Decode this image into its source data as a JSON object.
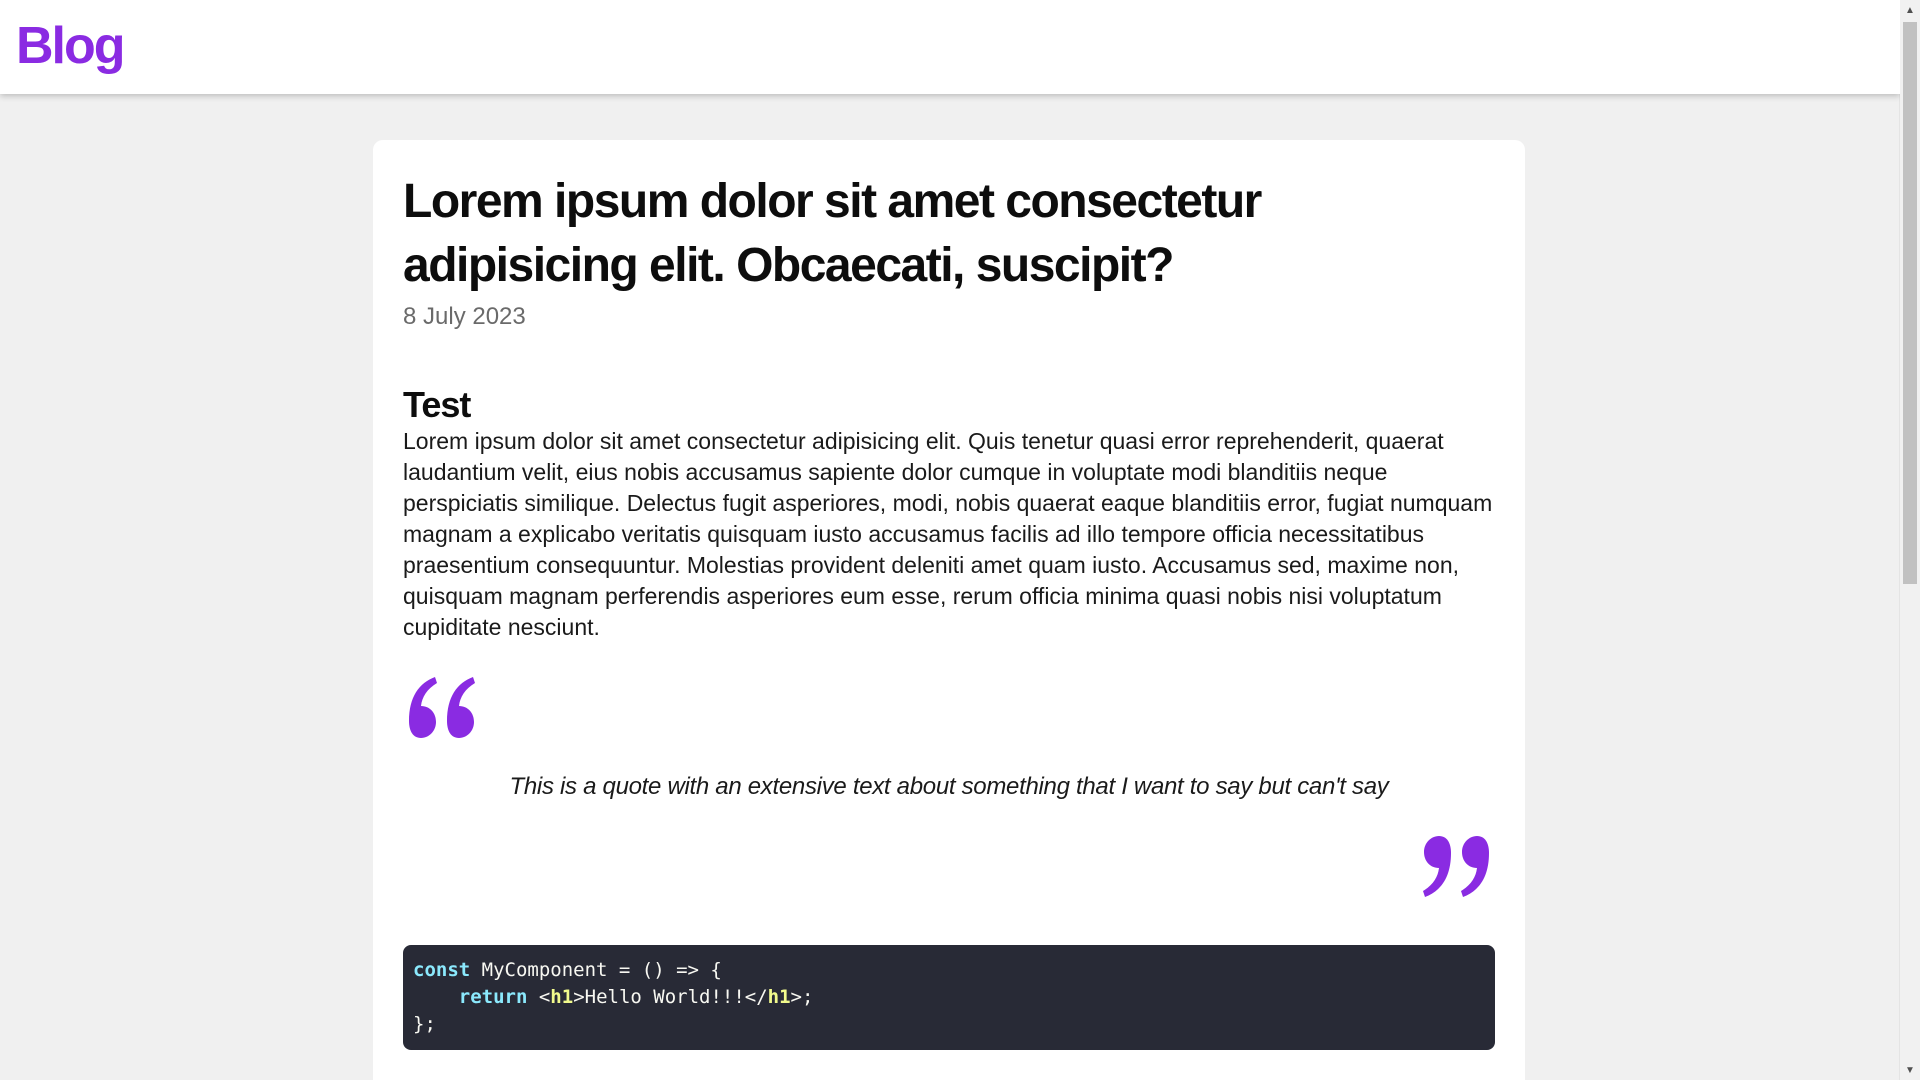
{
  "header": {
    "brand": "Blog",
    "brand_color": "#8a2be2"
  },
  "post": {
    "title": "Lorem ipsum dolor sit amet consectetur adipisicing elit. Obcaecati, suscipit?",
    "date": "8 July 2023",
    "section_heading": "Test",
    "paragraph": "Lorem ipsum dolor sit amet consectetur adipisicing elit. Quis tenetur quasi error reprehenderit, quaerat laudantium velit, eius nobis accusamus sapiente dolor cumque in voluptate modi blanditiis neque perspiciatis similique. Delectus fugit asperiores, modi, nobis quaerat eaque blanditiis error, fugiat numquam magnam a explicabo veritatis quisquam iusto accusamus facilis ad illo tempore officia necessitatibus praesentium consequuntur. Molestias provident deleniti amet quam iusto. Accusamus sed, maxime non, quisquam magnam perferendis asperiores eum esse, rerum officia minima quasi nobis nisi voluptatum cupiditate nesciunt.",
    "quote": {
      "open_icon": "quote-open-icon",
      "close_icon": "quote-close-icon",
      "text": "This is a quote with an extensive text about something that I want to say but can't say"
    },
    "code": {
      "line1_kw": "const",
      "line1_rest": " MyComponent = () => {",
      "line2_indent": "    ",
      "line2_kw": "return",
      "line2_pre": " <",
      "line2_tag_open": "h1",
      "line2_mid": ">Hello World!!!</",
      "line2_tag_close": "h1",
      "line2_end": ">;",
      "line3": "};"
    }
  },
  "colors": {
    "accent": "#8a2be2",
    "code_bg": "#282a36",
    "code_keyword": "#8be9fd",
    "code_tag": "#f1fa8c"
  },
  "scrollbar": {
    "up_icon": "scroll-up-arrow-icon",
    "down_icon": "scroll-down-arrow-icon"
  }
}
